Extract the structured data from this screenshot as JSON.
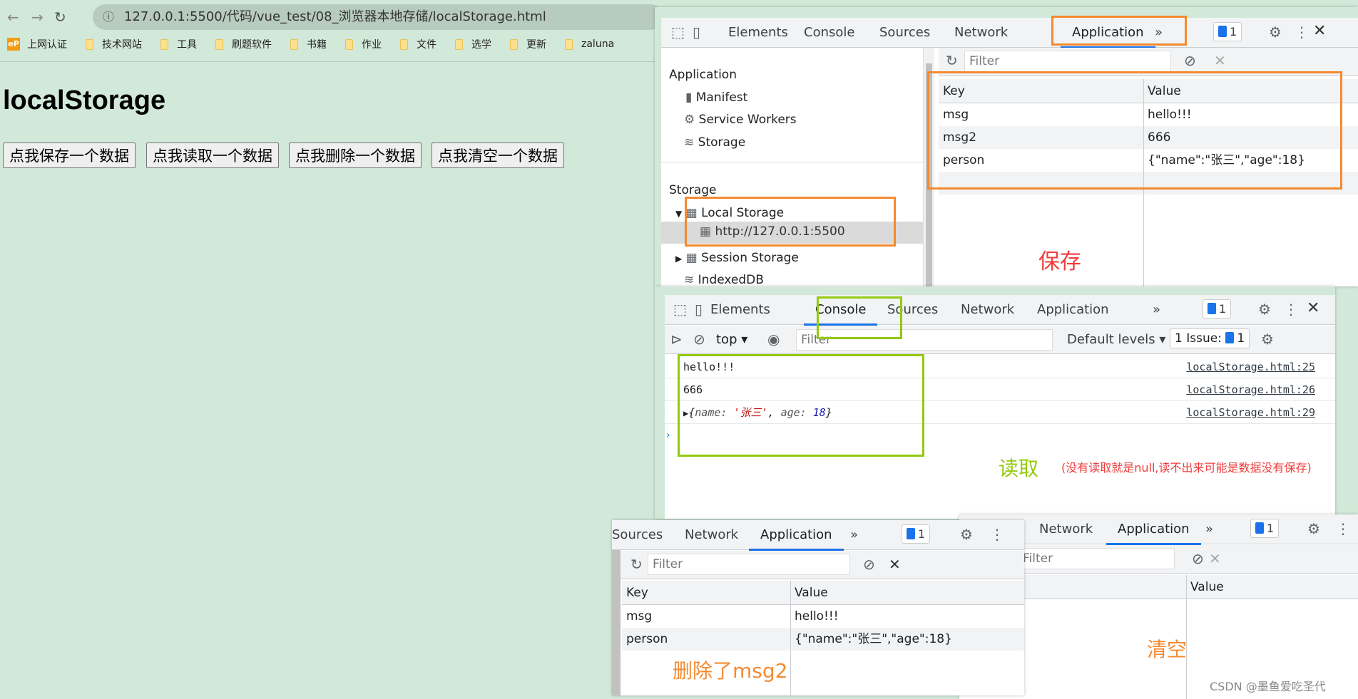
{
  "browser": {
    "url": "127.0.0.1:5500/代码/vue_test/08_浏览器本地存储/localStorage.html",
    "bookmarks": [
      "上网认证",
      "技术网站",
      "工具",
      "刷题软件",
      "书籍",
      "作业",
      "文件",
      "选学",
      "更新",
      "zaluna"
    ]
  },
  "page": {
    "title": "localStorage",
    "buttons": [
      "点我保存一个数据",
      "点我读取一个数据",
      "点我删除一个数据",
      "点我清空一个数据"
    ]
  },
  "devtools_save": {
    "tabs": [
      "Elements",
      "Console",
      "Sources",
      "Network",
      "Application"
    ],
    "active_tab": "Application",
    "issues": "1",
    "sidebar": {
      "app_header": "Application",
      "app_items": [
        "Manifest",
        "Service Workers",
        "Storage"
      ],
      "storage_header": "Storage",
      "local_storage": "Local Storage",
      "origin": "http://127.0.0.1:5500",
      "session_storage": "Session Storage",
      "indexeddb": "IndexedDB"
    },
    "filter_placeholder": "Filter",
    "columns": [
      "Key",
      "Value"
    ],
    "rows": [
      {
        "key": "msg",
        "value": "hello!!!"
      },
      {
        "key": "msg2",
        "value": "666"
      },
      {
        "key": "person",
        "value": "{\"name\":\"张三\",\"age\":18}"
      }
    ],
    "annotation": "保存"
  },
  "devtools_read": {
    "tabs": [
      "Elements",
      "Console",
      "Sources",
      "Network",
      "Application"
    ],
    "active_tab": "Console",
    "issues": "1",
    "context": "top",
    "filter_placeholder": "Filter",
    "levels": "Default levels",
    "issue_label": "1 Issue:",
    "issue_count": "1",
    "logs": [
      {
        "text": "hello!!!",
        "source": "localStorage.html:25"
      },
      {
        "text": "666",
        "source": "localStorage.html:26"
      },
      {
        "obj_open": "{",
        "name_key": "name: ",
        "name_val": "'张三'",
        "sep": ", ",
        "age_key": "age: ",
        "age_val": "18",
        "obj_close": "}",
        "source": "localStorage.html:29"
      }
    ],
    "annotation": "读取",
    "note": "(没有读取就是null,读不出来可能是数据没有保存)"
  },
  "devtools_delete": {
    "tabs": [
      "Sources",
      "Network",
      "Application"
    ],
    "active_tab": "Application",
    "issues": "1",
    "filter_placeholder": "Filter",
    "columns": [
      "Key",
      "Value"
    ],
    "rows": [
      {
        "key": "msg",
        "value": "hello!!!"
      },
      {
        "key": "person",
        "value": "{\"name\":\"张三\",\"age\":18}"
      }
    ],
    "annotation": "删除了msg2"
  },
  "devtools_clear": {
    "tabs": [
      "Network",
      "Application"
    ],
    "active_tab": "Application",
    "issues": "1",
    "filter_placeholder": "Filter",
    "columns": [
      "Value"
    ],
    "annotation": "清空"
  },
  "watermark": "CSDN @墨鱼爱吃圣代",
  "colors": {
    "page_bg": "#d2e8d9",
    "devtools_accent": "#1a73e8",
    "save_box": "#f48a30",
    "read_box": "#93c90f",
    "save_text": "#f03c3c",
    "read_text": "#93c90f",
    "note_text": "#f03c3c",
    "delete_text": "#f48a30"
  }
}
